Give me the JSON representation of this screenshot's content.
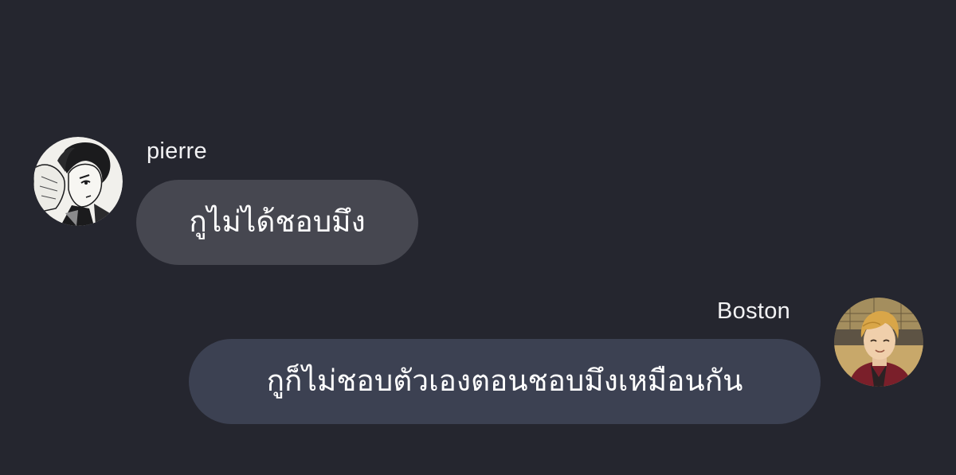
{
  "conversation": {
    "messages": [
      {
        "sender": "pierre",
        "text": "กูไม่ได้ชอบมึง",
        "avatar": "anime-boy-sketch-avatar",
        "side": "left",
        "bubble_color": "#464750"
      },
      {
        "sender": "Boston",
        "text": "กูก็ไม่ชอบตัวเองตอนชอบมึงเหมือนกัน",
        "avatar": "anime-blond-boy-avatar",
        "side": "right",
        "bubble_color": "#3c4152"
      }
    ]
  },
  "colors": {
    "background": "#25262f",
    "text": "#ffffff"
  }
}
